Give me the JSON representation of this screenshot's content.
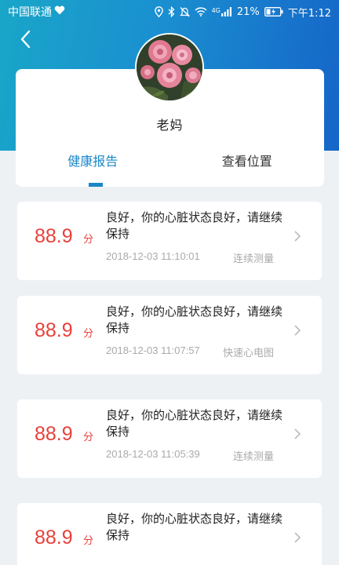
{
  "status_bar": {
    "carrier": "中国联通",
    "battery": "21%",
    "time": "下午1:12",
    "signal_label": "4G"
  },
  "profile": {
    "name": "老妈"
  },
  "tabs": [
    {
      "label": "健康报告",
      "active": true
    },
    {
      "label": "查看位置",
      "active": false
    }
  ],
  "reports": [
    {
      "score": "88.9",
      "unit": "分",
      "text": "良好，你的心脏状态良好，请继续保持",
      "time": "2018-12-03 11:10:01",
      "type": "连续测量"
    },
    {
      "score": "88.9",
      "unit": "分",
      "text": "良好，你的心脏状态良好，请继续保持",
      "time": "2018-12-03 11:07:57",
      "type": "快速心电图"
    },
    {
      "score": "88.9",
      "unit": "分",
      "text": "良好，你的心脏状态良好，请继续保持",
      "time": "2018-12-03 11:05:39",
      "type": "连续测量"
    },
    {
      "score": "88.9",
      "unit": "分",
      "text": "良好，你的心脏状态良好，请继续保持",
      "time": "",
      "type": ""
    }
  ],
  "colors": {
    "accent": "#1a86c8",
    "score": "#e8413b",
    "header_start": "#19a6c8",
    "header_end": "#1565c8"
  }
}
